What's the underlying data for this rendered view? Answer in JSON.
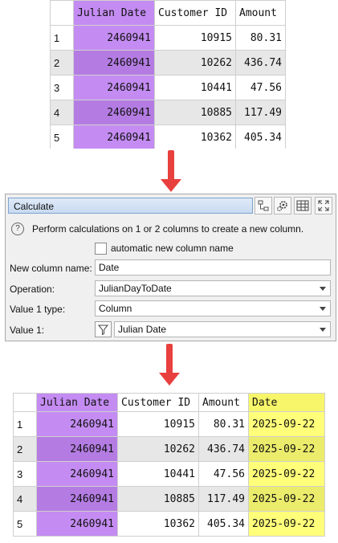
{
  "top_table": {
    "headers": [
      "",
      "Julian Date",
      "Customer ID",
      "Amount"
    ],
    "rows": [
      [
        "1",
        "2460941",
        "10915",
        "80.31"
      ],
      [
        "2",
        "2460941",
        "10262",
        "436.74"
      ],
      [
        "3",
        "2460941",
        "10441",
        "47.56"
      ],
      [
        "4",
        "2460941",
        "10885",
        "117.49"
      ],
      [
        "5",
        "2460941",
        "10362",
        "405.34"
      ]
    ]
  },
  "panel": {
    "title": "Calculate",
    "help_text": "Perform calculations on 1 or 2 columns to create a new column.",
    "help_icon": "?",
    "auto_name_label": "automatic new column name",
    "new_column_label": "New column name:",
    "new_column_value": "Date",
    "operation_label": "Operation:",
    "operation_value": "JulianDayToDate",
    "value1_type_label": "Value 1 type:",
    "value1_type_value": "Column",
    "value1_label": "Value 1:",
    "value1_value": "Julian Date",
    "toolbar_icons": [
      "hierarchy-icon",
      "gears-icon",
      "table-icon",
      "expand-icon"
    ]
  },
  "bottom_table": {
    "headers": [
      "",
      "Julian Date",
      "Customer ID",
      "Amount",
      "Date"
    ],
    "rows": [
      [
        "1",
        "2460941",
        "10915",
        "80.31",
        "2025-09-22"
      ],
      [
        "2",
        "2460941",
        "10262",
        "436.74",
        "2025-09-22"
      ],
      [
        "3",
        "2460941",
        "10441",
        "47.56",
        "2025-09-22"
      ],
      [
        "4",
        "2460941",
        "10885",
        "117.49",
        "2025-09-22"
      ],
      [
        "5",
        "2460941",
        "10362",
        "405.34",
        "2025-09-22"
      ]
    ]
  },
  "colors": {
    "highlight_purple": "#c48cf2",
    "highlight_yellow": "#ffff7a",
    "arrow": "#e8403e"
  }
}
